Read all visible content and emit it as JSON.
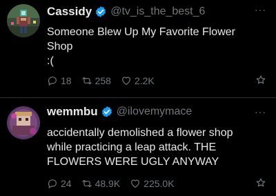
{
  "colors": {
    "background": "#000000",
    "text_primary": "#e7e9ea",
    "text_secondary": "#71767b",
    "verified": "#1d9bf0",
    "divider": "#2f3336"
  },
  "posts": [
    {
      "display_name": "Cassidy",
      "handle": "@tv_is_the_best_6",
      "more_label": "···",
      "verified_icon": "verified-badge-icon",
      "text_lines": [
        "Someone Blew Up My Favorite Flower",
        "Shop",
        ":("
      ],
      "replies": "18",
      "reposts": "258",
      "likes": "2.2K"
    },
    {
      "display_name": "wemmbu",
      "handle": "@ilovemymace",
      "more_label": "···",
      "verified_icon": "verified-badge-icon",
      "text_lines": [
        "accidentally demolished a flower shop",
        "while practicing a leap attack. THE",
        "FLOWERS WERE UGLY ANYWAY"
      ],
      "replies": "24",
      "reposts": "48.9K",
      "likes": "225.0K"
    }
  ]
}
